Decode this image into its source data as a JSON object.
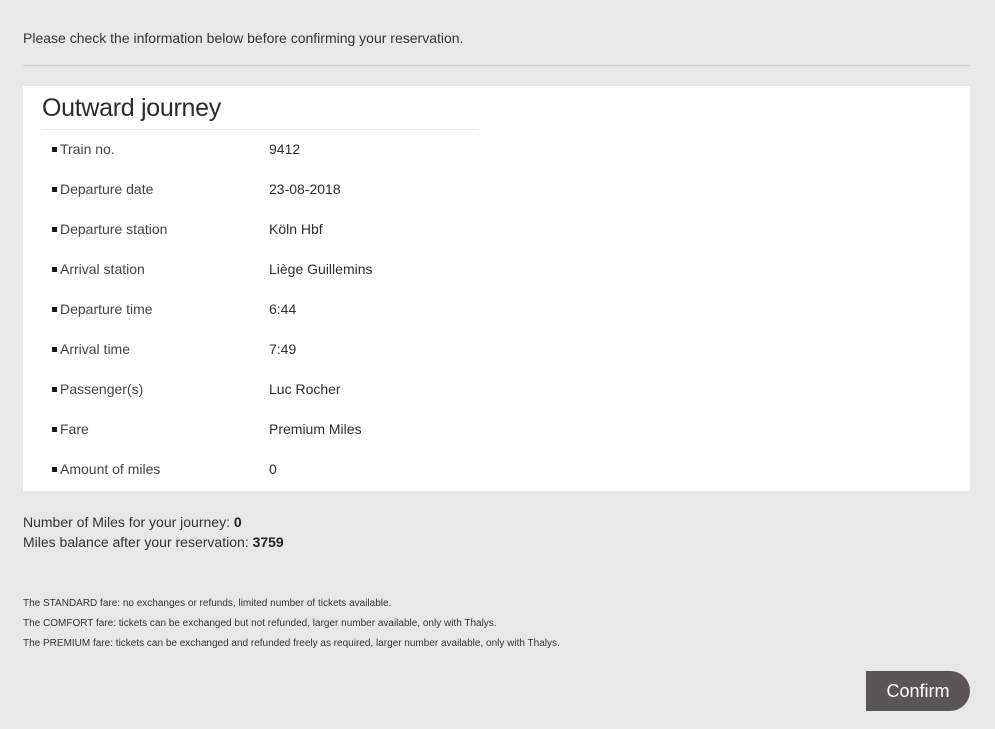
{
  "intro_text": "Please check the information below before confirming your reservation.",
  "journey": {
    "title": "Outward journey",
    "rows": [
      {
        "label": "Train no.",
        "value": "9412"
      },
      {
        "label": "Departure date",
        "value": "23-08-2018"
      },
      {
        "label": "Departure station",
        "value": "Köln Hbf"
      },
      {
        "label": "Arrival station",
        "value": "Liège Guillemins"
      },
      {
        "label": "Departure time",
        "value": "6:44"
      },
      {
        "label": "Arrival time",
        "value": "7:49"
      },
      {
        "label": "Passenger(s)",
        "value": "Luc Rocher"
      },
      {
        "label": "Fare",
        "value": "Premium Miles"
      },
      {
        "label": "Amount of miles",
        "value": "0"
      }
    ]
  },
  "summary": {
    "miles_label": "Number of Miles for your journey:",
    "miles_value": "0",
    "balance_label": "Miles balance after your reservation:",
    "balance_value": "3759"
  },
  "fares": [
    "The STANDARD fare: no exchanges or refunds, limited number of tickets available.",
    "The COMFORT fare: tickets can be exchanged but not refunded, larger number available, only with Thalys.",
    "The PREMIUM fare: tickets can be exchanged and refunded freely as required, larger number available, only with Thalys."
  ],
  "confirm_label": "Confirm"
}
